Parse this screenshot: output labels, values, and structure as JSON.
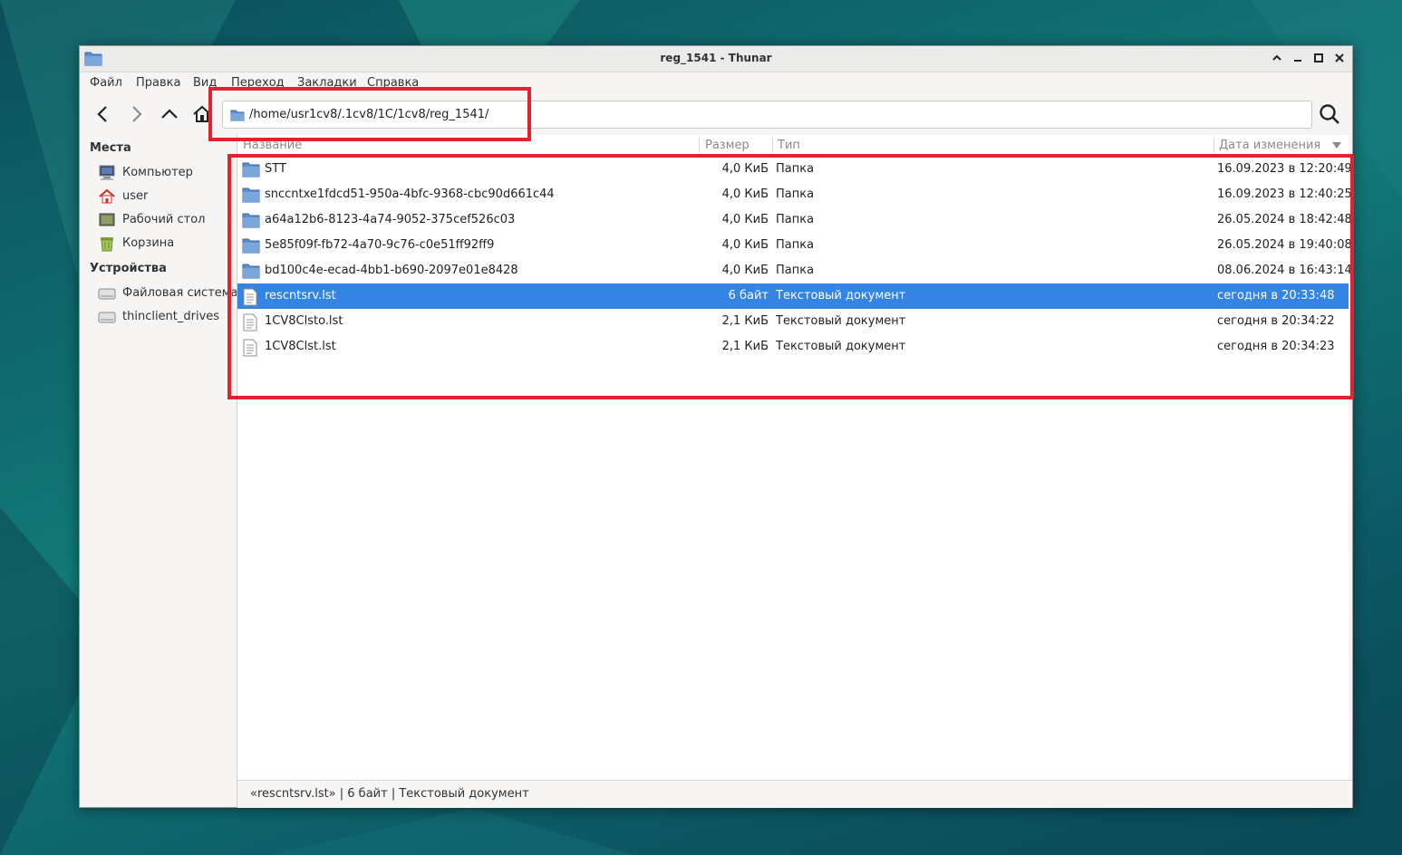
{
  "window": {
    "title": "reg_1541 - Thunar",
    "controls": [
      "minimize-up-icon",
      "minimize-icon",
      "maximize-icon",
      "close-icon"
    ]
  },
  "menubar": {
    "items": [
      "Файл",
      "Правка",
      "Вид",
      "Переход",
      "Закладки",
      "Справка"
    ]
  },
  "toolbar": {
    "buttons": [
      "back-icon",
      "forward-icon",
      "up-icon",
      "home-icon",
      "search-icon"
    ],
    "path": "/home/usr1cv8/.1cv8/1C/1cv8/reg_1541/"
  },
  "sidebar": {
    "places_heading": "Места",
    "places": [
      {
        "label": "Компьютер",
        "icon": "computer-icon"
      },
      {
        "label": "user",
        "icon": "home-icon"
      },
      {
        "label": "Рабочий стол",
        "icon": "desktop-icon"
      },
      {
        "label": "Корзина",
        "icon": "trash-icon"
      }
    ],
    "devices_heading": "Устройства",
    "devices": [
      {
        "label": "Файловая система",
        "icon": "drive-icon"
      },
      {
        "label": "thinclient_drives",
        "icon": "drive-icon",
        "eject": "eject-icon"
      }
    ]
  },
  "columns": {
    "name": "Название",
    "size": "Размер",
    "type": "Тип",
    "date": "Дата изменения"
  },
  "files": [
    {
      "name": "STT",
      "size": "4,0 КиБ",
      "type": "Папка",
      "date": "16.09.2023 в 12:20:49",
      "icon": "folder-icon",
      "selected": false
    },
    {
      "name": "snccntxe1fdcd51-950a-4bfc-9368-cbc90d661c44",
      "size": "4,0 КиБ",
      "type": "Папка",
      "date": "16.09.2023 в 12:40:25",
      "icon": "folder-icon",
      "selected": false
    },
    {
      "name": "a64a12b6-8123-4a74-9052-375cef526c03",
      "size": "4,0 КиБ",
      "type": "Папка",
      "date": "26.05.2024 в 18:42:48",
      "icon": "folder-icon",
      "selected": false
    },
    {
      "name": "5e85f09f-fb72-4a70-9c76-c0e51ff92ff9",
      "size": "4,0 КиБ",
      "type": "Папка",
      "date": "26.05.2024 в 19:40:08",
      "icon": "folder-icon",
      "selected": false
    },
    {
      "name": "bd100c4e-ecad-4bb1-b690-2097e01e8428",
      "size": "4,0 КиБ",
      "type": "Папка",
      "date": "08.06.2024 в 16:43:14",
      "icon": "folder-icon",
      "selected": false
    },
    {
      "name": "rescntsrv.lst",
      "size": "6 байт",
      "type": "Текстовый документ",
      "date": "сегодня в 20:33:48",
      "icon": "text-file-icon",
      "selected": true
    },
    {
      "name": "1CV8Clsto.lst",
      "size": "2,1 КиБ",
      "type": "Текстовый документ",
      "date": "сегодня в 20:34:22",
      "icon": "text-file-icon",
      "selected": false
    },
    {
      "name": "1CV8Clst.lst",
      "size": "2,1 КиБ",
      "type": "Текстовый документ",
      "date": "сегодня в 20:34:23",
      "icon": "text-file-icon",
      "selected": false
    }
  ],
  "statusbar": {
    "text": "«rescntsrv.lst»  |  6 байт  |  Текстовый документ"
  },
  "colors": {
    "selection": "#3584e4",
    "highlight_box": "#e3222f",
    "folder": "#5d8fcf"
  }
}
